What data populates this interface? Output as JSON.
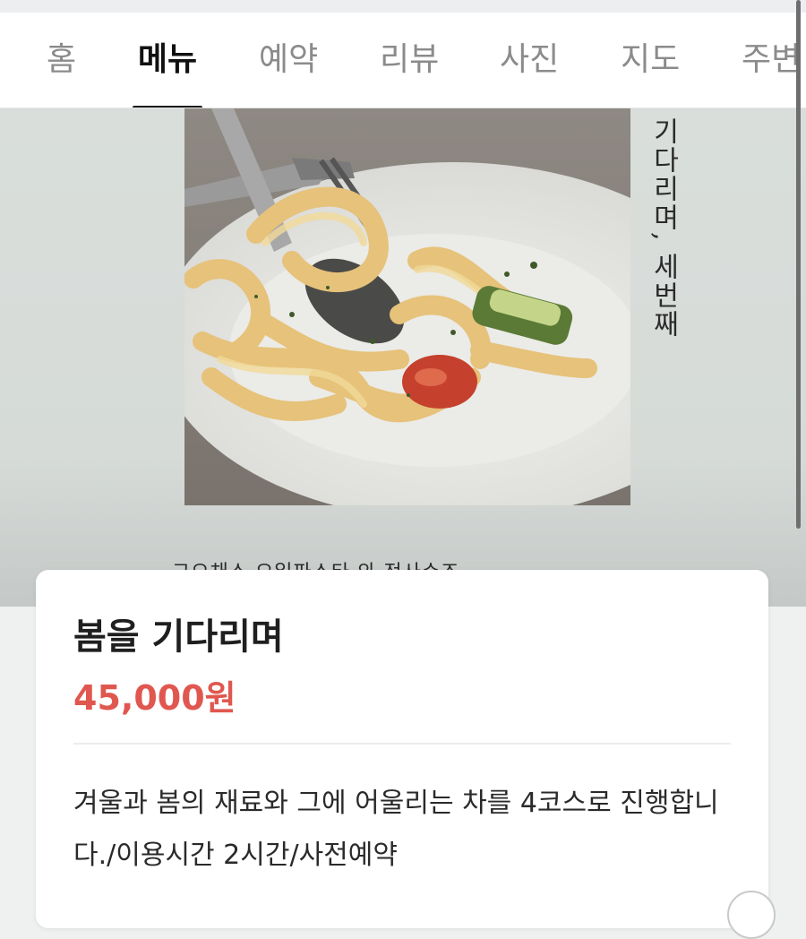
{
  "tabs": [
    {
      "label": "홈",
      "active": false
    },
    {
      "label": "메뉴",
      "active": true
    },
    {
      "label": "예약",
      "active": false
    },
    {
      "label": "리뷰",
      "active": false
    },
    {
      "label": "사진",
      "active": false
    },
    {
      "label": "지도",
      "active": false
    },
    {
      "label": "주변",
      "active": false
    }
  ],
  "hero": {
    "vertical_title": "기다리며, 세번째",
    "caption": "그으채소 오일파스타 와 전사수조"
  },
  "menu": {
    "name": "봄을 기다리며",
    "price": "45,000원",
    "description": "겨울과 봄의 재료와 그에 어울리는 차를 4코스로 진행합니다./이용시간 2시간/사전예약"
  },
  "colors": {
    "price": "#e0574f",
    "active_tab": "#111111",
    "inactive_tab": "#8b8b8b",
    "hero_bg": "#d9dedb"
  }
}
